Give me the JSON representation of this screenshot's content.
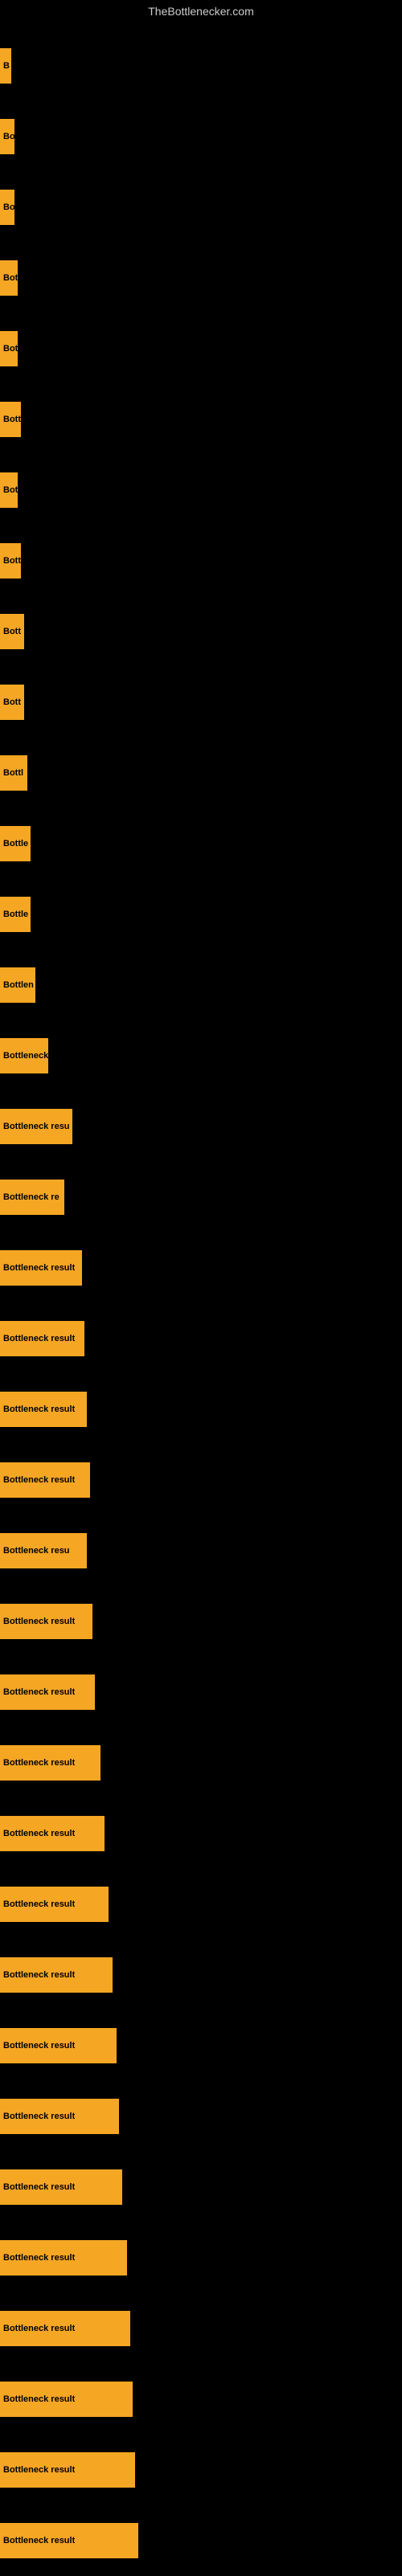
{
  "site": {
    "title": "TheBottlenecker.com"
  },
  "bars": [
    {
      "label": "B",
      "width": 14
    },
    {
      "label": "Bo",
      "width": 18
    },
    {
      "label": "Bo",
      "width": 18
    },
    {
      "label": "Bot",
      "width": 22
    },
    {
      "label": "Bot",
      "width": 22
    },
    {
      "label": "Bott",
      "width": 26
    },
    {
      "label": "Bot",
      "width": 22
    },
    {
      "label": "Bott",
      "width": 26
    },
    {
      "label": "Bott",
      "width": 30
    },
    {
      "label": "Bott",
      "width": 30
    },
    {
      "label": "Bottl",
      "width": 34
    },
    {
      "label": "Bottle",
      "width": 38
    },
    {
      "label": "Bottle",
      "width": 38
    },
    {
      "label": "Bottlen",
      "width": 44
    },
    {
      "label": "Bottleneck",
      "width": 60
    },
    {
      "label": "Bottleneck resu",
      "width": 90
    },
    {
      "label": "Bottleneck re",
      "width": 80
    },
    {
      "label": "Bottleneck result",
      "width": 102
    },
    {
      "label": "Bottleneck result",
      "width": 105
    },
    {
      "label": "Bottleneck result",
      "width": 108
    },
    {
      "label": "Bottleneck result",
      "width": 112
    },
    {
      "label": "Bottleneck resu",
      "width": 108
    },
    {
      "label": "Bottleneck result",
      "width": 115
    },
    {
      "label": "Bottleneck result",
      "width": 118
    },
    {
      "label": "Bottleneck result",
      "width": 125
    },
    {
      "label": "Bottleneck result",
      "width": 130
    },
    {
      "label": "Bottleneck result",
      "width": 135
    },
    {
      "label": "Bottleneck result",
      "width": 140
    },
    {
      "label": "Bottleneck result",
      "width": 145
    },
    {
      "label": "Bottleneck result",
      "width": 148
    },
    {
      "label": "Bottleneck result",
      "width": 152
    },
    {
      "label": "Bottleneck result",
      "width": 158
    },
    {
      "label": "Bottleneck result",
      "width": 162
    },
    {
      "label": "Bottleneck result",
      "width": 165
    },
    {
      "label": "Bottleneck result",
      "width": 168
    },
    {
      "label": "Bottleneck result",
      "width": 172
    }
  ]
}
